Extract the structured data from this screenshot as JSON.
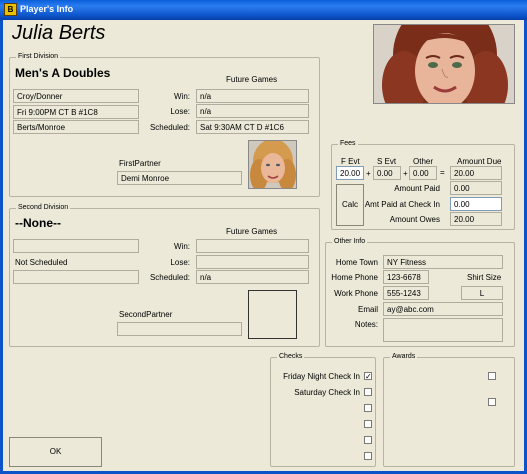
{
  "window": {
    "title": "Player's Info",
    "icon": "app-icon"
  },
  "player": {
    "name": "Julia Berts"
  },
  "first_division": {
    "group_label": "First Division",
    "name": "Men's A Doubles",
    "field_1": "Croy/Donner",
    "field_2": "Fri 9:00PM  CT B  #1C8",
    "field_3": "Berts/Monroe",
    "future_games_label": "Future Games",
    "win_label": "Win:",
    "win": "n/a",
    "lose_label": "Lose:",
    "lose": "n/a",
    "scheduled_label": "Scheduled:",
    "scheduled": "Sat 9:30AM  CT D  #1C6",
    "partner_label": "FirstPartner",
    "partner": "Demi Monroe"
  },
  "second_division": {
    "group_label": "Second Division",
    "name": "--None--",
    "field_1": "",
    "status": "Not Scheduled",
    "field_3": "",
    "future_games_label": "Future Games",
    "win_label": "Win:",
    "win": "",
    "lose_label": "Lose:",
    "lose": "",
    "scheduled_label": "Scheduled:",
    "scheduled": "n/a",
    "partner_label": "SecondPartner",
    "partner": ""
  },
  "fees": {
    "group_label": "Fees",
    "f_evt_label": "F Evt",
    "s_evt_label": "S Evt",
    "other_label": "Other",
    "amount_due_label": "Amount Due",
    "f_evt": "20.00",
    "s_evt": "0.00",
    "other": "0.00",
    "amount_due": "20.00",
    "plus_1": "+",
    "plus_2": "+",
    "equals": "=",
    "amount_paid_label": "Amount Paid",
    "amount_paid": "0.00",
    "amt_paid_checkin_label": "Amt Paid at Check In",
    "amt_paid_checkin": "0.00",
    "amount_owes_label": "Amount Owes",
    "amount_owes": "20.00",
    "calc_label": "Calc"
  },
  "other_info": {
    "group_label": "Other Info",
    "home_town_label": "Home Town",
    "home_town": "NY Fitness",
    "home_phone_label": "Home Phone",
    "home_phone": "123-6678",
    "shirt_size_label": "Shirt Size",
    "shirt_size": "L",
    "work_phone_label": "Work Phone",
    "work_phone": "555-1243",
    "email_label": "Email",
    "email": "ay@abc.com",
    "notes_label": "Notes:",
    "notes": ""
  },
  "checks": {
    "group_label": "Checks",
    "items": [
      {
        "label": "Friday Night Check In",
        "mark": "✓"
      },
      {
        "label": "Saturday Check In",
        "mark": ""
      },
      {
        "label": "",
        "mark": ""
      },
      {
        "label": "",
        "mark": ""
      },
      {
        "label": "",
        "mark": ""
      },
      {
        "label": "",
        "mark": ""
      }
    ]
  },
  "awards": {
    "group_label": "Awards"
  },
  "ok_label": "OK"
}
